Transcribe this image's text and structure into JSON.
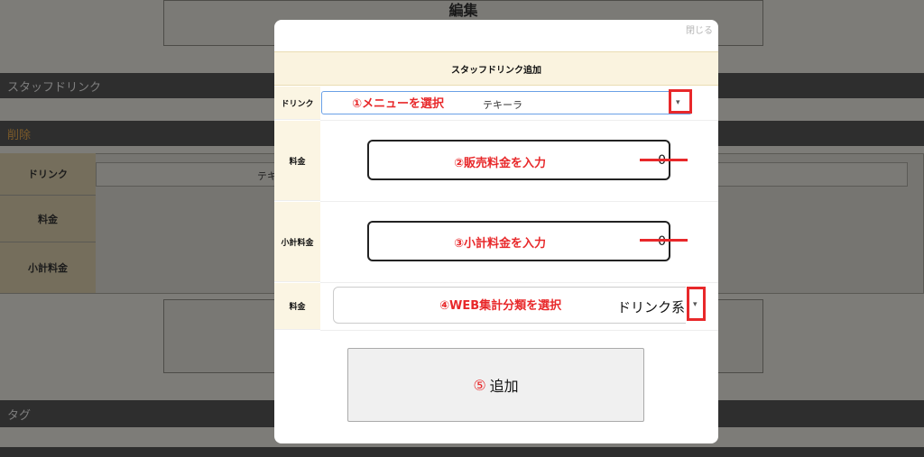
{
  "background": {
    "edit_label": "編集",
    "staff_drink_bar": "スタッフドリンク",
    "delete_bar": "削除",
    "table": {
      "rows": [
        {
          "label": "ドリンク",
          "value": "テキ"
        },
        {
          "label": "料金",
          "value": ""
        },
        {
          "label": "小計料金",
          "value": ""
        }
      ]
    },
    "tag_bar": "タグ"
  },
  "modal": {
    "close_label": "閉じる",
    "title": "スタッフドリンク追加",
    "drink": {
      "label": "ドリンク",
      "selected": "テキーラ",
      "annotation": "①メニューを選択"
    },
    "price": {
      "label": "料金",
      "value": "0",
      "annotation": "②販売料金を入力"
    },
    "subtotal": {
      "label": "小計料金",
      "value": "0",
      "annotation": "③小計料金を入力"
    },
    "category": {
      "label": "料金",
      "selected": "ドリンク系",
      "annotation": "④WEB集計分類を選択"
    },
    "add_button": {
      "number": "⑤",
      "label": "追加"
    }
  },
  "colors": {
    "annotation_red": "#e8282a",
    "header_cream": "#faf3df",
    "overlay": "#7d7c78"
  },
  "icons": {
    "dropdown": "chevron-down-icon"
  }
}
